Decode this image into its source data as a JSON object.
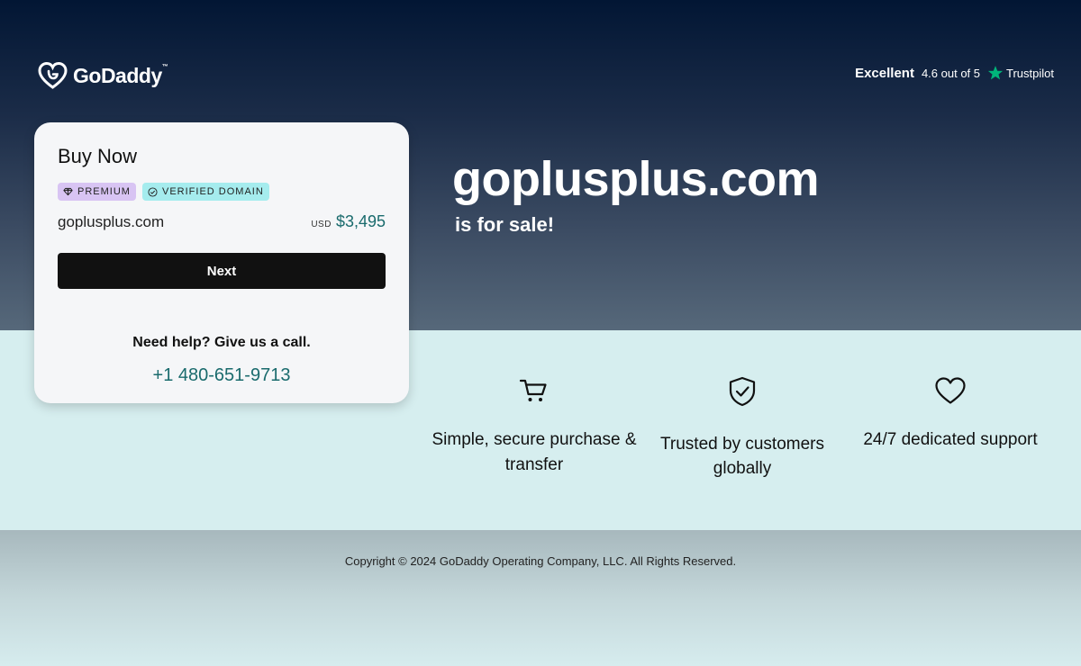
{
  "brand": {
    "name": "GoDaddy",
    "tm": "™"
  },
  "rating": {
    "label": "Excellent",
    "score": "4.6 out of 5",
    "provider": "Trustpilot",
    "star_color": "#00b67a"
  },
  "card": {
    "title": "Buy Now",
    "badges": {
      "premium": "PREMIUM",
      "verified": "VERIFIED DOMAIN"
    },
    "domain": "goplusplus.com",
    "currency": "USD",
    "price": "$3,495",
    "next_label": "Next",
    "help_text": "Need help? Give us a call.",
    "phone": "+1 480-651-9713"
  },
  "hero": {
    "domain": "goplusplus.com",
    "subtitle": "is for sale!"
  },
  "features": [
    {
      "icon": "cart-icon",
      "text": "Simple, secure purchase & transfer"
    },
    {
      "icon": "shield-check-icon",
      "text": "Trusted by customers globally"
    },
    {
      "icon": "heart-icon",
      "text": "24/7 dedicated support"
    }
  ],
  "footer": {
    "copyright": "Copyright © 2024 GoDaddy Operating Company, LLC. All Rights Reserved."
  },
  "colors": {
    "accent_teal": "#1a6b6d",
    "premium_badge": "#d8c4f3",
    "verified_badge": "#a5ecee",
    "button": "#111111"
  }
}
